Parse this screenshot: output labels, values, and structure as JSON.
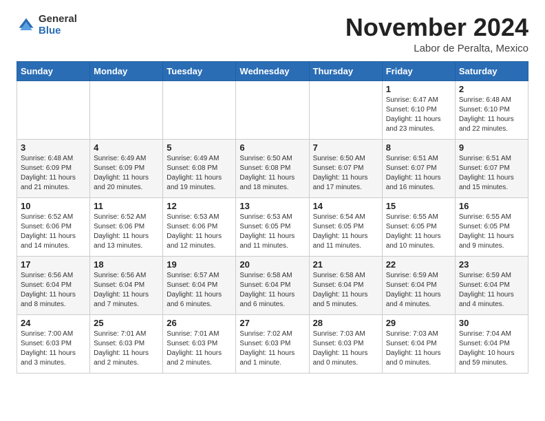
{
  "header": {
    "logo_line1": "General",
    "logo_line2": "Blue",
    "month": "November 2024",
    "location": "Labor de Peralta, Mexico"
  },
  "weekdays": [
    "Sunday",
    "Monday",
    "Tuesday",
    "Wednesday",
    "Thursday",
    "Friday",
    "Saturday"
  ],
  "weeks": [
    [
      {
        "day": "",
        "info": ""
      },
      {
        "day": "",
        "info": ""
      },
      {
        "day": "",
        "info": ""
      },
      {
        "day": "",
        "info": ""
      },
      {
        "day": "",
        "info": ""
      },
      {
        "day": "1",
        "info": "Sunrise: 6:47 AM\nSunset: 6:10 PM\nDaylight: 11 hours\nand 23 minutes."
      },
      {
        "day": "2",
        "info": "Sunrise: 6:48 AM\nSunset: 6:10 PM\nDaylight: 11 hours\nand 22 minutes."
      }
    ],
    [
      {
        "day": "3",
        "info": "Sunrise: 6:48 AM\nSunset: 6:09 PM\nDaylight: 11 hours\nand 21 minutes."
      },
      {
        "day": "4",
        "info": "Sunrise: 6:49 AM\nSunset: 6:09 PM\nDaylight: 11 hours\nand 20 minutes."
      },
      {
        "day": "5",
        "info": "Sunrise: 6:49 AM\nSunset: 6:08 PM\nDaylight: 11 hours\nand 19 minutes."
      },
      {
        "day": "6",
        "info": "Sunrise: 6:50 AM\nSunset: 6:08 PM\nDaylight: 11 hours\nand 18 minutes."
      },
      {
        "day": "7",
        "info": "Sunrise: 6:50 AM\nSunset: 6:07 PM\nDaylight: 11 hours\nand 17 minutes."
      },
      {
        "day": "8",
        "info": "Sunrise: 6:51 AM\nSunset: 6:07 PM\nDaylight: 11 hours\nand 16 minutes."
      },
      {
        "day": "9",
        "info": "Sunrise: 6:51 AM\nSunset: 6:07 PM\nDaylight: 11 hours\nand 15 minutes."
      }
    ],
    [
      {
        "day": "10",
        "info": "Sunrise: 6:52 AM\nSunset: 6:06 PM\nDaylight: 11 hours\nand 14 minutes."
      },
      {
        "day": "11",
        "info": "Sunrise: 6:52 AM\nSunset: 6:06 PM\nDaylight: 11 hours\nand 13 minutes."
      },
      {
        "day": "12",
        "info": "Sunrise: 6:53 AM\nSunset: 6:06 PM\nDaylight: 11 hours\nand 12 minutes."
      },
      {
        "day": "13",
        "info": "Sunrise: 6:53 AM\nSunset: 6:05 PM\nDaylight: 11 hours\nand 11 minutes."
      },
      {
        "day": "14",
        "info": "Sunrise: 6:54 AM\nSunset: 6:05 PM\nDaylight: 11 hours\nand 11 minutes."
      },
      {
        "day": "15",
        "info": "Sunrise: 6:55 AM\nSunset: 6:05 PM\nDaylight: 11 hours\nand 10 minutes."
      },
      {
        "day": "16",
        "info": "Sunrise: 6:55 AM\nSunset: 6:05 PM\nDaylight: 11 hours\nand 9 minutes."
      }
    ],
    [
      {
        "day": "17",
        "info": "Sunrise: 6:56 AM\nSunset: 6:04 PM\nDaylight: 11 hours\nand 8 minutes."
      },
      {
        "day": "18",
        "info": "Sunrise: 6:56 AM\nSunset: 6:04 PM\nDaylight: 11 hours\nand 7 minutes."
      },
      {
        "day": "19",
        "info": "Sunrise: 6:57 AM\nSunset: 6:04 PM\nDaylight: 11 hours\nand 6 minutes."
      },
      {
        "day": "20",
        "info": "Sunrise: 6:58 AM\nSunset: 6:04 PM\nDaylight: 11 hours\nand 6 minutes."
      },
      {
        "day": "21",
        "info": "Sunrise: 6:58 AM\nSunset: 6:04 PM\nDaylight: 11 hours\nand 5 minutes."
      },
      {
        "day": "22",
        "info": "Sunrise: 6:59 AM\nSunset: 6:04 PM\nDaylight: 11 hours\nand 4 minutes."
      },
      {
        "day": "23",
        "info": "Sunrise: 6:59 AM\nSunset: 6:04 PM\nDaylight: 11 hours\nand 4 minutes."
      }
    ],
    [
      {
        "day": "24",
        "info": "Sunrise: 7:00 AM\nSunset: 6:03 PM\nDaylight: 11 hours\nand 3 minutes."
      },
      {
        "day": "25",
        "info": "Sunrise: 7:01 AM\nSunset: 6:03 PM\nDaylight: 11 hours\nand 2 minutes."
      },
      {
        "day": "26",
        "info": "Sunrise: 7:01 AM\nSunset: 6:03 PM\nDaylight: 11 hours\nand 2 minutes."
      },
      {
        "day": "27",
        "info": "Sunrise: 7:02 AM\nSunset: 6:03 PM\nDaylight: 11 hours\nand 1 minute."
      },
      {
        "day": "28",
        "info": "Sunrise: 7:03 AM\nSunset: 6:03 PM\nDaylight: 11 hours\nand 0 minutes."
      },
      {
        "day": "29",
        "info": "Sunrise: 7:03 AM\nSunset: 6:04 PM\nDaylight: 11 hours\nand 0 minutes."
      },
      {
        "day": "30",
        "info": "Sunrise: 7:04 AM\nSunset: 6:04 PM\nDaylight: 10 hours\nand 59 minutes."
      }
    ]
  ]
}
